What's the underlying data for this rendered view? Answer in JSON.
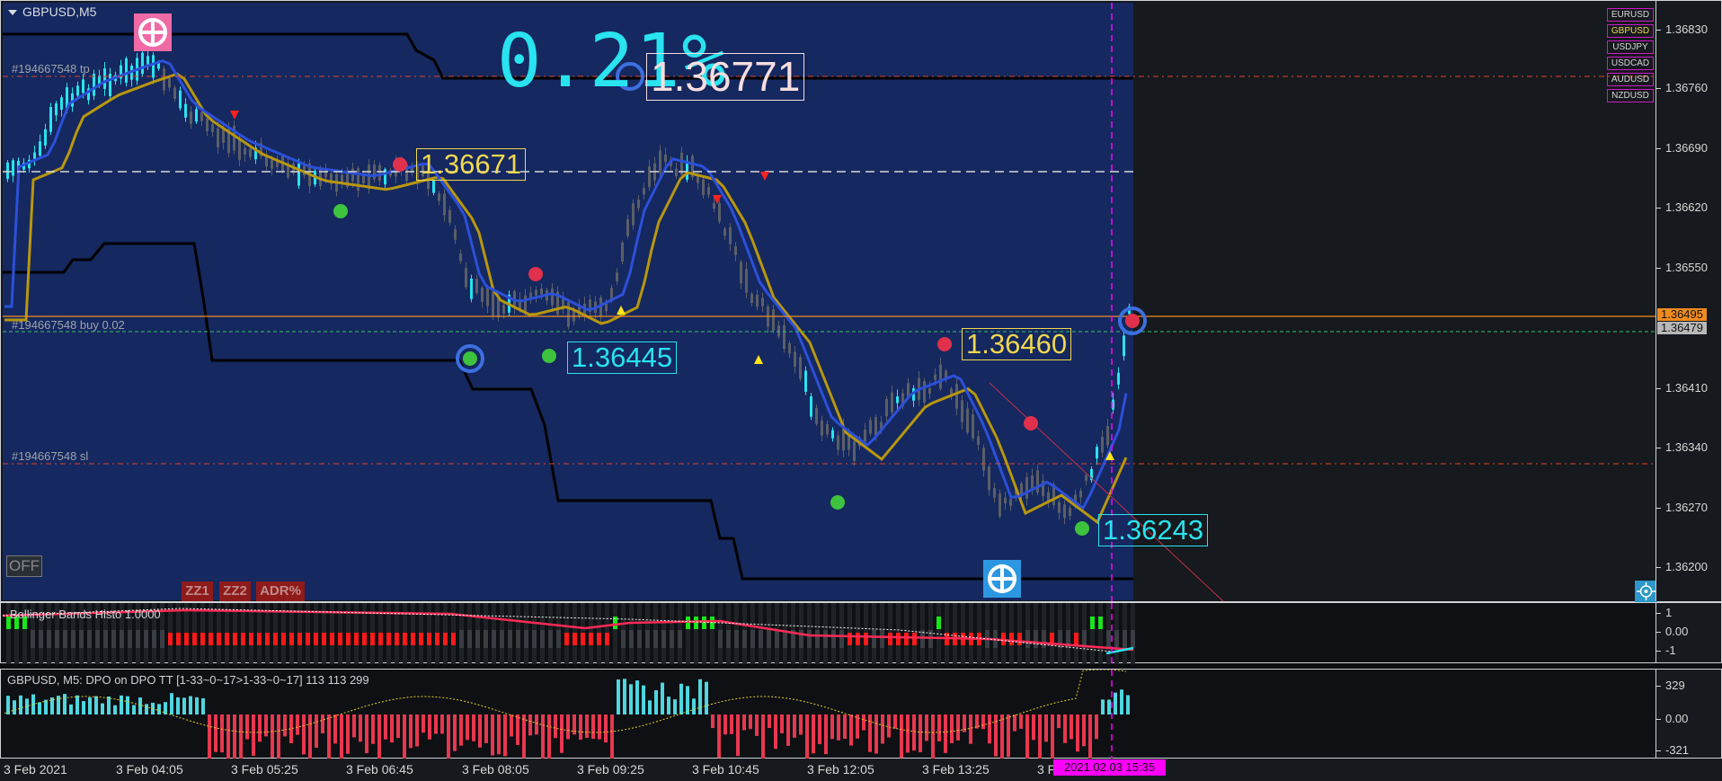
{
  "window": {
    "title": "GBPUSD,M5"
  },
  "big_percent": "0.21%",
  "price_boxes": {
    "box1": "1.36771",
    "box2": "1.36671",
    "box3": "1.36460",
    "box4": "1.36445",
    "box5": "1.36243"
  },
  "trade_labels": {
    "tp": "#194667548 tp",
    "buy": "#194667548 buy 0.02",
    "sl": "#194667548 sl"
  },
  "symbols": [
    {
      "name": "EURUSD",
      "active": false
    },
    {
      "name": "GBPUSD",
      "active": true
    },
    {
      "name": "USDJPY",
      "active": false
    },
    {
      "name": "USDCAD",
      "active": false
    },
    {
      "name": "AUDUSD",
      "active": false
    },
    {
      "name": "NZDUSD",
      "active": false
    }
  ],
  "y_axis": {
    "ticks": [
      "1.36830",
      "1.36760",
      "1.36690",
      "1.36620",
      "1.36550",
      "1.36410",
      "1.36340",
      "1.36270",
      "1.36200"
    ],
    "current_price": "1.36495",
    "current_price_color": "#f28b1e",
    "buy_price": "1.36479",
    "buy_price_color": "#b8b8b8"
  },
  "buttons": {
    "off": "OFF",
    "zz1": "ZZ1",
    "zz2": "ZZ2",
    "adr": "ADR%"
  },
  "bb_pane": {
    "title": "Bollinger Bands Histo 1.0000",
    "ticks": [
      "1",
      "0.00",
      "-1"
    ]
  },
  "dpo_pane": {
    "title": "GBPUSD, M5: DPO on DPO TT [1-33~0~17>1-33~0~17]  113 113 299",
    "ticks": [
      "329",
      "0.00",
      "-321"
    ]
  },
  "time_axis": {
    "labels": [
      "3 Feb 2021",
      "3 Feb 04:05",
      "3 Feb 05:25",
      "3 Feb 06:45",
      "3 Feb 08:05",
      "3 Feb 09:25",
      "3 Feb 10:45",
      "3 Feb 12:05",
      "3 Feb 13:25",
      "3 F"
    ],
    "crosshair": "2021.02.03 15:35"
  },
  "colors": {
    "chart_area": "#15285f",
    "future_area": "#16191d",
    "bull_candle": "#29e3ef",
    "bear_candle": "#5b5f66",
    "ma_gold": "#b8970f",
    "ma_blue": "#2c50d9",
    "envelope": "#000000",
    "crosshair": "#ff00ff"
  }
}
